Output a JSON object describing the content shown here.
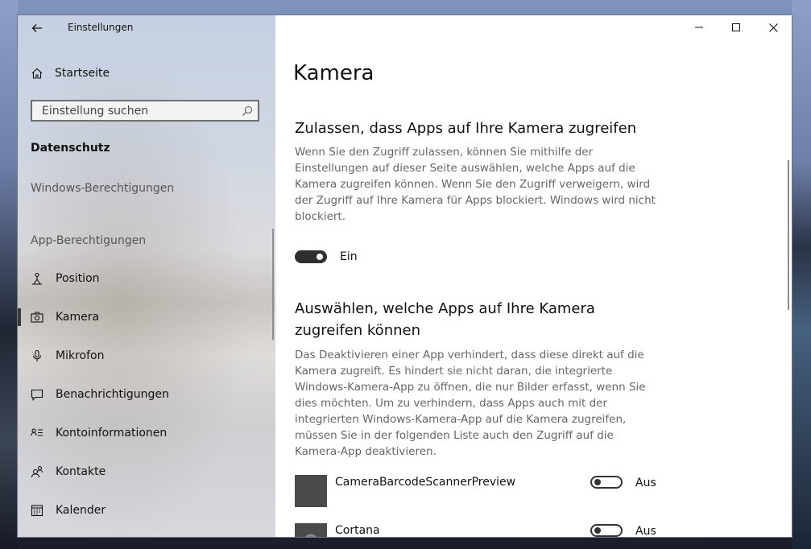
{
  "window": {
    "title": "Einstellungen",
    "controls": {
      "minimize": "minimize-icon",
      "maximize": "maximize-icon",
      "close": "close-icon"
    }
  },
  "sidebar": {
    "home_label": "Startseite",
    "search_placeholder": "Einstellung suchen",
    "section_title": "Datenschutz",
    "group_windows": "Windows-Berechtigungen",
    "group_apps": "App-Berechtigungen",
    "items": [
      {
        "label": "Position",
        "icon": "person-location-icon"
      },
      {
        "label": "Kamera",
        "icon": "camera-icon",
        "active": true
      },
      {
        "label": "Mikrofon",
        "icon": "microphone-icon"
      },
      {
        "label": "Benachrichtigungen",
        "icon": "notification-icon"
      },
      {
        "label": "Kontoinformationen",
        "icon": "account-info-icon"
      },
      {
        "label": "Kontakte",
        "icon": "contacts-icon"
      },
      {
        "label": "Kalender",
        "icon": "calendar-icon"
      }
    ]
  },
  "main": {
    "title": "Kamera",
    "access": {
      "heading": "Zulassen, dass Apps auf Ihre Kamera zugreifen",
      "description": "Wenn Sie den Zugriff zulassen, können Sie mithilfe der Einstellungen auf dieser Seite auswählen, welche Apps auf die Kamera zugreifen können. Wenn Sie den Zugriff verweigern, wird der Zugriff auf Ihre Kamera für Apps blockiert. Windows wird nicht blockiert.",
      "toggle_label": "Ein",
      "toggle_on": true
    },
    "choose": {
      "heading": "Auswählen, welche Apps auf Ihre Kamera zugreifen können",
      "description": "Das Deaktivieren einer App verhindert, dass diese direkt auf die Kamera zugreift. Es hindert sie nicht daran, die integrierte Windows-Kamera-App zu öffnen, die nur Bilder erfasst, wenn Sie dies möchten. Um zu verhindern, dass Apps auch mit der integrierten Windows-Kamera-App auf die Kamera zugreifen, müssen Sie in der folgenden Liste auch den Zugriff auf die Kamera-App deaktivieren."
    },
    "apps": [
      {
        "name": "CameraBarcodeScannerPreview",
        "toggle_label": "Aus",
        "on": false
      },
      {
        "name": "Cortana",
        "toggle_label": "Aus",
        "on": false
      }
    ]
  }
}
